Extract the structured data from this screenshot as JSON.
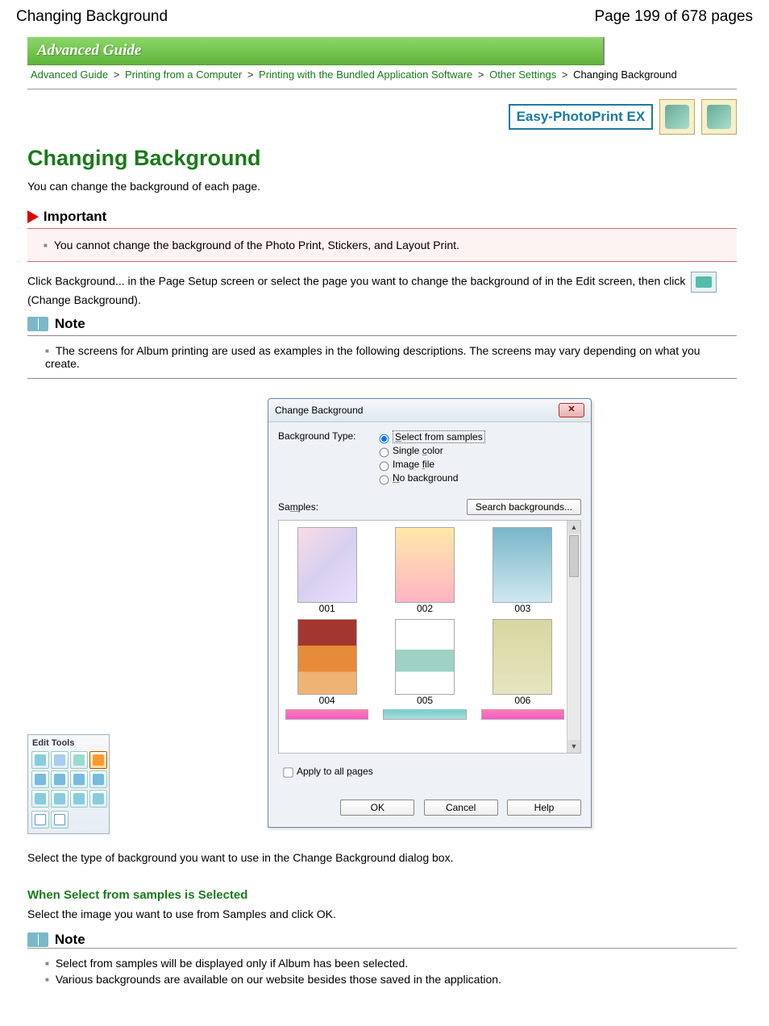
{
  "page_header": {
    "title": "Changing Background",
    "page_indicator": "Page 199 of 678 pages"
  },
  "banner": "Advanced Guide",
  "breadcrumbs": {
    "items": [
      "Advanced Guide",
      "Printing from a Computer",
      "Printing with the Bundled Application Software",
      "Other Settings"
    ],
    "current": "Changing Background"
  },
  "brand": "Easy-PhotoPrint EX",
  "h1": "Changing Background",
  "intro": "You can change the background of each page.",
  "important": {
    "title": "Important",
    "items": [
      "You cannot change the background of the Photo Print, Stickers, and Layout Print."
    ]
  },
  "body": {
    "p1a": "Click Background... in the Page Setup screen or select the page you want to change the background of in the Edit screen, then click ",
    "p1b": " (Change Background).",
    "icon_name": "change-background-icon"
  },
  "note1": {
    "title": "Note",
    "items": [
      "The screens for Album printing are used as examples in the following descriptions. The screens may vary depending on what you create."
    ]
  },
  "palette": {
    "title": "Edit Tools"
  },
  "dialog": {
    "title": "Change Background",
    "bg_type_label": "Background Type:",
    "options": {
      "o1": "Select from samples",
      "o2": "Single color",
      "o3": "Image file",
      "o4": "No background"
    },
    "samples_label": "Samples:",
    "search_btn": "Search backgrounds...",
    "thumbs": [
      "001",
      "002",
      "003",
      "004",
      "005",
      "006"
    ],
    "apply_all": "Apply to all pages",
    "ok": "OK",
    "cancel": "Cancel",
    "help": "Help"
  },
  "after_dialog": "Select the type of background you want to use in the Change Background dialog box.",
  "section2": {
    "heading": "When Select from samples is Selected",
    "text": "Select the image you want to use from Samples and click OK."
  },
  "note2": {
    "title": "Note",
    "items": [
      "Select from samples will be displayed only if Album has been selected.",
      "Various backgrounds are available on our website besides those saved in the application."
    ]
  }
}
